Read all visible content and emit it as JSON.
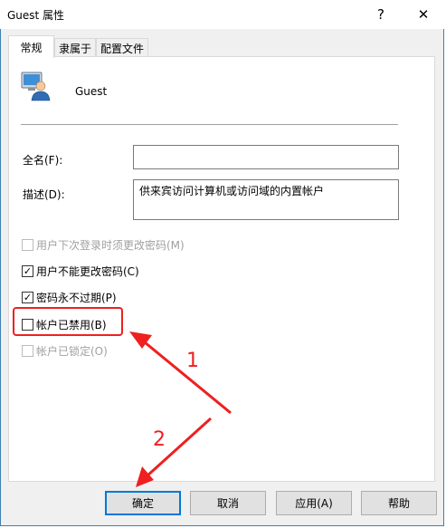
{
  "window": {
    "title": "Guest 属性",
    "help_glyph": "?",
    "close_glyph": "✕"
  },
  "tabs": [
    {
      "label": "常规",
      "active": true
    },
    {
      "label": "隶属于",
      "active": false
    },
    {
      "label": "配置文件",
      "active": false
    }
  ],
  "user": {
    "name": "Guest",
    "icon": "user-account-icon"
  },
  "fields": {
    "full_name": {
      "label": "全名(F):",
      "value": ""
    },
    "description": {
      "label": "描述(D):",
      "value": "供来宾访问计算机或访问域的内置帐户"
    }
  },
  "checkboxes": [
    {
      "label": "用户下次登录时须更改密码(M)",
      "checked": false,
      "enabled": false
    },
    {
      "label": "用户不能更改密码(C)",
      "checked": true,
      "enabled": true
    },
    {
      "label": "密码永不过期(P)",
      "checked": true,
      "enabled": true
    },
    {
      "label": "帐户已禁用(B)",
      "checked": false,
      "enabled": true
    },
    {
      "label": "帐户已锁定(O)",
      "checked": false,
      "enabled": false
    }
  ],
  "buttons": {
    "ok": "确定",
    "cancel": "取消",
    "apply": "应用(A)",
    "help": "帮助"
  },
  "annotations": {
    "step1": "1",
    "step2": "2"
  },
  "colors": {
    "accent": "#0078d7",
    "annotation": "#ee2020"
  }
}
